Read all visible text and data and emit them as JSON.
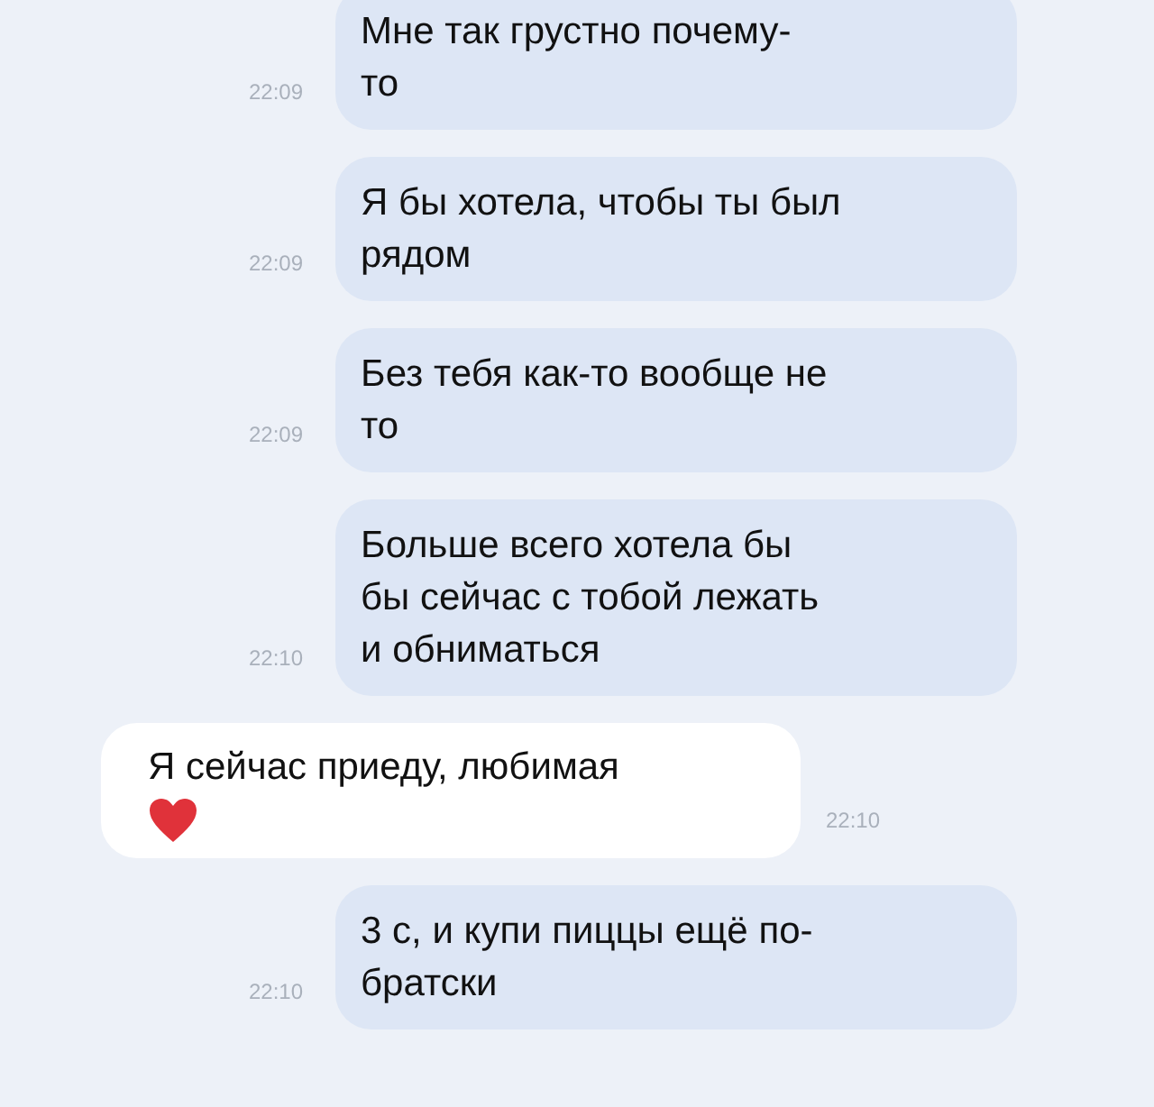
{
  "messages": [
    {
      "kind": "outgoing",
      "lines": [
        "Мне так грустно почему-",
        "то"
      ],
      "time": "22:09"
    },
    {
      "kind": "outgoing",
      "lines": [
        "Я бы хотела, чтобы ты был",
        "рядом"
      ],
      "time": "22:09"
    },
    {
      "kind": "outgoing",
      "lines": [
        "Без тебя как-то вообще не",
        "то"
      ],
      "time": "22:09"
    },
    {
      "kind": "outgoing",
      "lines": [
        "Больше всего хотела бы",
        "бы сейчас с тобой лежать",
        "и обниматься"
      ],
      "time": "22:10"
    },
    {
      "kind": "incoming",
      "lines": [
        "Я сейчас приеду, любимая"
      ],
      "heart": true,
      "time": "22:10"
    },
    {
      "kind": "outgoing",
      "lines": [
        "3  с, и купи пиццы ещё по-",
        "братски"
      ],
      "time": "22:10"
    }
  ]
}
